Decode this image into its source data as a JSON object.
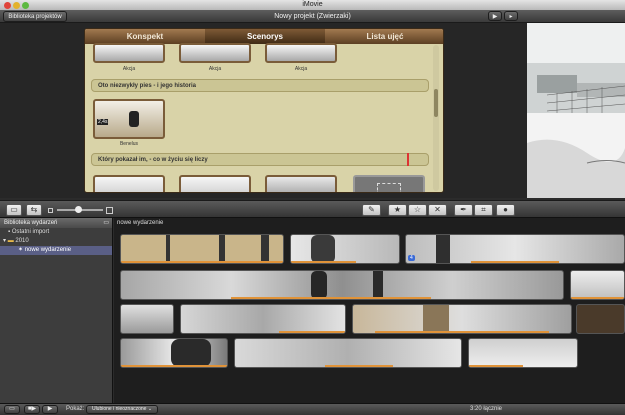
{
  "window": {
    "title": "iMovie"
  },
  "project_bar": {
    "library_button": "Biblioteka projektów",
    "project_title": "Nowy projekt (Zwierzaki)"
  },
  "storyboard": {
    "tabs": [
      {
        "label": "Konspekt"
      },
      {
        "label": "Scenorys"
      },
      {
        "label": "Lista ujęć"
      }
    ],
    "top_captions": [
      "Akcja",
      "Akcja",
      "Akcja"
    ],
    "section1": "Oto niezwykły pies - i jego historia",
    "clip_duration": "2,4s",
    "clip_caption": "Benelus",
    "section2": "Który pokazał im, - co w życiu się liczy"
  },
  "event_library": {
    "header": "Biblioteka wydarzeń",
    "items": [
      {
        "label": "Ostatni import"
      },
      {
        "label": "2010"
      },
      {
        "label": "nowe wydarzenie"
      }
    ]
  },
  "event_browser": {
    "header": "nowe wydarzenie",
    "badge": "4"
  },
  "bottom_bar": {
    "show_label": "Pokaż:",
    "filter_value": "Ulubione i nieoznaczone",
    "total": "3:20 łącznie"
  },
  "icons": [
    "star-icon",
    "unstar-icon",
    "reject-icon",
    "dropper-icon",
    "crop-icon",
    "info-icon"
  ]
}
